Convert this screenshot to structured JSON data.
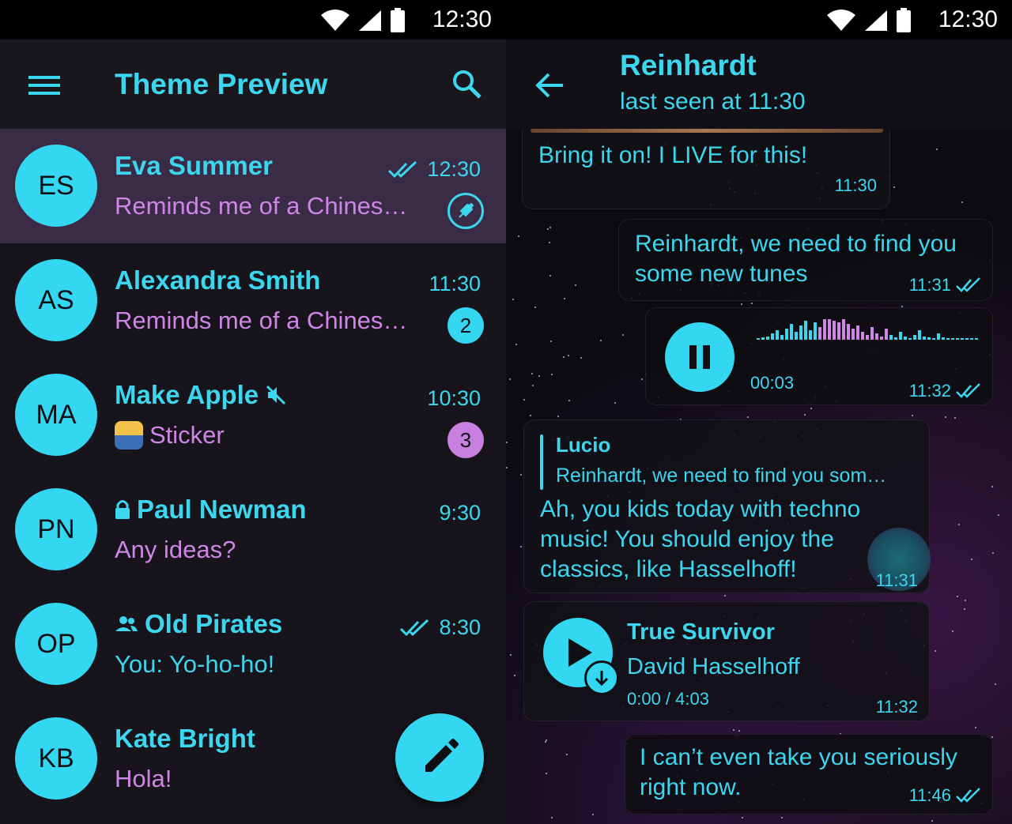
{
  "status": {
    "time": "12:30"
  },
  "left": {
    "title": "Theme Preview",
    "chats": [
      {
        "initials": "ES",
        "name": "Eva Summer",
        "time": "12:30",
        "read": true,
        "preview": "Reminds me of a Chines…",
        "pinned": true
      },
      {
        "initials": "AS",
        "name": "Alexandra Smith",
        "time": "11:30",
        "preview": "Reminds me of a Chines…",
        "badge": "2"
      },
      {
        "initials": "MA",
        "name": "Make Apple",
        "time": "10:30",
        "muted": true,
        "preview": "Sticker",
        "badge": "3"
      },
      {
        "initials": "PN",
        "name": "Paul Newman",
        "time": "9:30",
        "secret": true,
        "preview": "Any ideas?"
      },
      {
        "initials": "OP",
        "name": "Old Pirates",
        "time": "8:30",
        "group": true,
        "read": true,
        "preview": "You: Yo-ho-ho!"
      },
      {
        "initials": "KB",
        "name": "Kate Bright",
        "preview": "Hola!"
      }
    ]
  },
  "right": {
    "name": "Reinhardt",
    "status": "last seen at 11:30",
    "messages": {
      "m1": {
        "text": "Bring it on! I LIVE for this!",
        "time": "11:30"
      },
      "m2": {
        "line1": "Reinhardt, we need to find you",
        "line2": "some new tunes",
        "time": "11:31"
      },
      "m3": {
        "duration": "00:03",
        "time": "11:32"
      },
      "m4": {
        "reply_name": "Lucio",
        "reply_text": "Reinhardt, we need to find you som…",
        "line1": "Ah, you kids today with techno",
        "line2": "music! You should enjoy the",
        "line3": "classics, like Hasselhoff!",
        "time": "11:31"
      },
      "m5": {
        "title": "True Survivor",
        "artist": "David Hasselhoff",
        "duration": "0:00 / 4:03",
        "time": "11:32"
      },
      "m6": {
        "line1": "I can’t even take you seriously",
        "line2": "right now.",
        "time": "11:46"
      }
    }
  },
  "colors": {
    "accent": "#33d7f1",
    "text_accent": "#3dd6ef",
    "preview": "#cf86e7",
    "active_row": "#3a2b46",
    "badge_purple": "#c77fe0"
  }
}
